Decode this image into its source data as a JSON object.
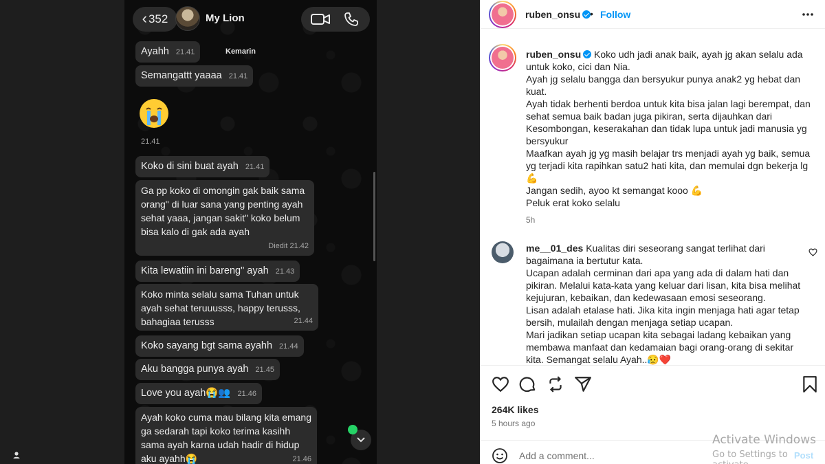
{
  "chat": {
    "back_count": "352",
    "contact_name": "My Lion",
    "day_label": "Kemarin",
    "messages": [
      {
        "text": "Ayahh",
        "time": "21.41"
      },
      {
        "text": "Semangattt yaaaa",
        "time": "21.41"
      },
      {
        "text": "😭",
        "time": "21.41"
      },
      {
        "text": "Koko di sini buat ayah",
        "time": "21.41"
      },
      {
        "text": "Ga pp koko di omongin gak baik sama orang\" di luar sana yang penting ayah sehat yaaa, jangan sakit\" koko belum bisa kalo di gak ada ayah",
        "time": "Diedit 21.42"
      },
      {
        "text": "Kita lewatiin ini bareng\" ayah",
        "time": "21.43"
      },
      {
        "text": "Koko minta selalu sama Tuhan untuk ayah sehat teruuusss, happy terusss, bahagiaa terusss",
        "time": "21.44"
      },
      {
        "text": "Koko sayang bgt sama ayahh",
        "time": "21.44"
      },
      {
        "text": "Aku bangga punya ayah",
        "time": "21.45"
      },
      {
        "text": "Love you ayah😭👥",
        "time": "21.46"
      },
      {
        "text": "Ayah koko cuma mau bilang kita emang ga sedarah tapi koko terima kasihh sama ayah karna udah hadir di hidup aku ayahh😭",
        "time": "21.46"
      }
    ]
  },
  "post": {
    "username": "ruben_onsu",
    "follow_label": "Follow",
    "caption_lines": [
      "Koko udh jadi anak baik, ayah jg akan selalu ada untuk koko, cici dan Nia.",
      "Ayah jg selalu bangga dan bersyukur punya anak2 yg hebat dan kuat.",
      "Ayah tidak berhenti berdoa untuk kita bisa jalan lagi berempat, dan sehat semua baik badan juga pikiran, serta dijauhkan dari Kesombongan, keserakahan dan tidak lupa untuk jadi manusia yg bersyukur",
      "Maafkan ayah jg yg masih belajar trs menjadi ayah yg baik, semua yg terjadi kita rapihkan satu2 hati kita, dan memulai dgn bekerja lg 💪",
      "Jangan sedih, ayoo kt semangat kooo 💪",
      "Peluk erat koko selalu"
    ],
    "caption_time": "5h",
    "comment": {
      "username": "me__01_des",
      "lines": [
        "Kualitas diri seseorang sangat terlihat dari bagaimana ia bertutur kata.",
        "Ucapan adalah cerminan dari apa yang ada di dalam hati dan pikiran. Melalui kata-kata yang keluar dari lisan, kita bisa melihat kejujuran, kebaikan, dan kedewasaan emosi seseorang.",
        "Lisan adalah etalase hati. Jika kita ingin menjaga hati agar tetap bersih, mulailah dengan menjaga setiap ucapan.",
        "Mari jadikan setiap ucapan kita sebagai ladang kebaikan yang membawa manfaat dan kedamaian bagi orang-orang di sekitar kita. Semangat selalu Ayah..😥❤️"
      ]
    },
    "likes": "264K likes",
    "posted_ago": "5 hours ago",
    "add_comment_placeholder": "Add a comment...",
    "post_label": "Post"
  },
  "watermark": {
    "line1": "Activate Windows",
    "line2": "Go to Settings to activate"
  },
  "colors": {
    "ig_blue": "#0095f6",
    "chat_bubble": "#2c2c2c",
    "online_green": "#25d366"
  }
}
